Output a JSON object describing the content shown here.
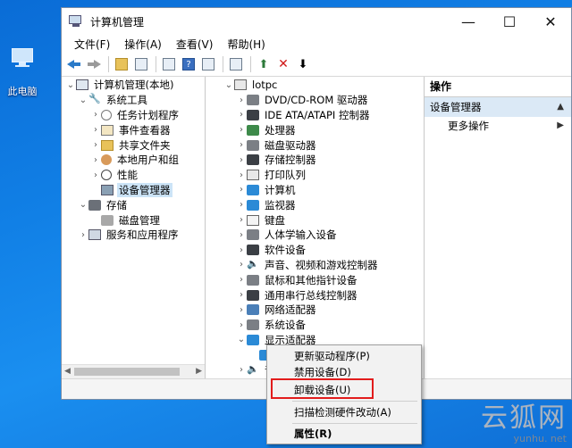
{
  "desktop": {
    "icon_label": "此电脑"
  },
  "window": {
    "title": "计算机管理",
    "controls": {
      "minimize": "—",
      "maximize": "☐",
      "close": "✕"
    }
  },
  "menu": [
    "文件(F)",
    "操作(A)",
    "查看(V)",
    "帮助(H)"
  ],
  "left_tree": [
    {
      "label": "计算机管理(本地)",
      "indent": 0,
      "exp": "⌄",
      "icon": "mgmt"
    },
    {
      "label": "系统工具",
      "indent": 1,
      "exp": "⌄",
      "icon": "tool"
    },
    {
      "label": "任务计划程序",
      "indent": 2,
      "exp": "›",
      "icon": "clock"
    },
    {
      "label": "事件查看器",
      "indent": 2,
      "exp": "›",
      "icon": "event"
    },
    {
      "label": "共享文件夹",
      "indent": 2,
      "exp": "›",
      "icon": "share"
    },
    {
      "label": "本地用户和组",
      "indent": 2,
      "exp": "›",
      "icon": "users"
    },
    {
      "label": "性能",
      "indent": 2,
      "exp": "›",
      "icon": "perf"
    },
    {
      "label": "设备管理器",
      "indent": 2,
      "exp": "",
      "icon": "devmgr",
      "selected": true
    },
    {
      "label": "存储",
      "indent": 1,
      "exp": "⌄",
      "icon": "storage"
    },
    {
      "label": "磁盘管理",
      "indent": 2,
      "exp": "",
      "icon": "disk"
    },
    {
      "label": "服务和应用程序",
      "indent": 1,
      "exp": "›",
      "icon": "svc"
    }
  ],
  "device_tree": [
    {
      "label": "lotpc",
      "indent": 0,
      "exp": "⌄",
      "icon": "dev-light"
    },
    {
      "label": "DVD/CD-ROM 驱动器",
      "indent": 1,
      "exp": "›",
      "icon": "dev-gray"
    },
    {
      "label": "IDE ATA/ATAPI 控制器",
      "indent": 1,
      "exp": "›",
      "icon": "dev-dark"
    },
    {
      "label": "处理器",
      "indent": 1,
      "exp": "›",
      "icon": "dev-green"
    },
    {
      "label": "磁盘驱动器",
      "indent": 1,
      "exp": "›",
      "icon": "dev-gray"
    },
    {
      "label": "存储控制器",
      "indent": 1,
      "exp": "›",
      "icon": "dev-dark"
    },
    {
      "label": "打印队列",
      "indent": 1,
      "exp": "›",
      "icon": "dev-light"
    },
    {
      "label": "计算机",
      "indent": 1,
      "exp": "›",
      "icon": "dev-blue"
    },
    {
      "label": "监视器",
      "indent": 1,
      "exp": "›",
      "icon": "dev-blue"
    },
    {
      "label": "键盘",
      "indent": 1,
      "exp": "›",
      "icon": "kb"
    },
    {
      "label": "人体学输入设备",
      "indent": 1,
      "exp": "›",
      "icon": "dev-gray"
    },
    {
      "label": "软件设备",
      "indent": 1,
      "exp": "›",
      "icon": "dev-dark"
    },
    {
      "label": "声音、视频和游戏控制器",
      "indent": 1,
      "exp": "›",
      "icon": "sound"
    },
    {
      "label": "鼠标和其他指针设备",
      "indent": 1,
      "exp": "›",
      "icon": "dev-gray"
    },
    {
      "label": "通用串行总线控制器",
      "indent": 1,
      "exp": "›",
      "icon": "dev-dark"
    },
    {
      "label": "网络适配器",
      "indent": 1,
      "exp": "›",
      "icon": "dev-net"
    },
    {
      "label": "系统设备",
      "indent": 1,
      "exp": "›",
      "icon": "dev-gray"
    },
    {
      "label": "显示适配器",
      "indent": 1,
      "exp": "⌄",
      "icon": "dev-blue"
    },
    {
      "label": "",
      "indent": 2,
      "exp": "",
      "icon": "dev-blue",
      "selected": true
    },
    {
      "label": "音频",
      "indent": 1,
      "exp": "›",
      "icon": "sound"
    }
  ],
  "actions": {
    "header": "操作",
    "section": "设备管理器",
    "item": "更多操作"
  },
  "context_menu": {
    "update_driver": "更新驱动程序(P)",
    "disable": "禁用设备(D)",
    "uninstall": "卸载设备(U)",
    "scan": "扫描检测硬件改动(A)",
    "properties": "属性(R)"
  },
  "watermark": {
    "big": "云狐网",
    "small": "yunhu. net"
  },
  "colors": {
    "highlight_box": "#e21c1c",
    "selection": "#cce4f7",
    "desktop": "#1180e6"
  }
}
